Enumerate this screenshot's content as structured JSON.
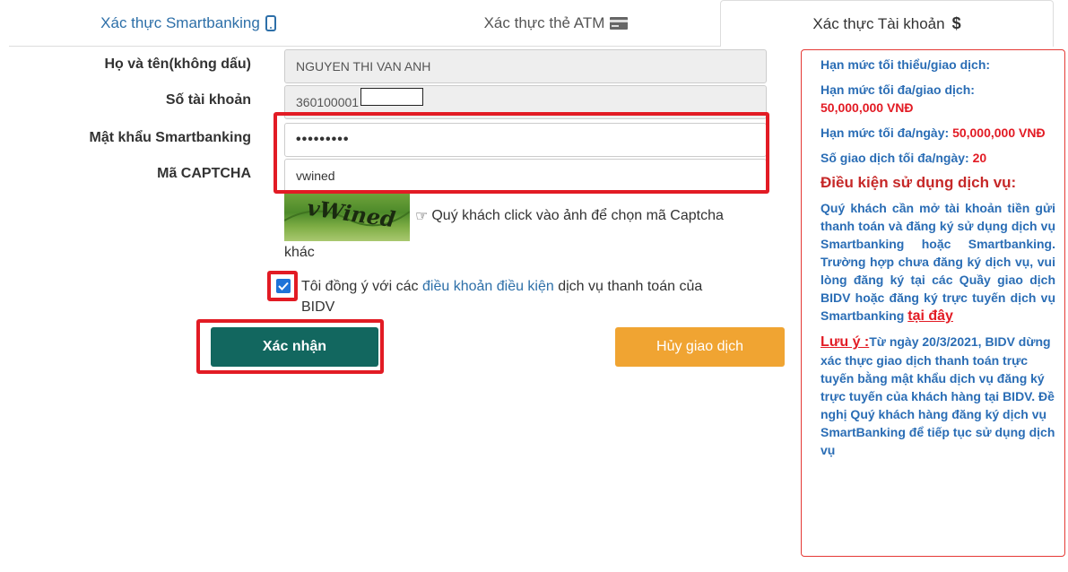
{
  "tabs": {
    "smartbanking": "Xác thực Smartbanking",
    "atm": "Xác thực thẻ ATM",
    "account": "Xác thực Tài khoản",
    "account_icon": "$"
  },
  "form": {
    "fullname_label": "Họ và tên(không dấu)",
    "fullname_value": "NGUYEN THI VAN ANH",
    "account_label": "Số tài khoản",
    "account_value": "360100001",
    "password_label": "Mật khẩu Smartbanking",
    "password_value": "•••••••••",
    "captcha_label": "Mã CAPTCHA",
    "captcha_value": "vwined",
    "captcha_image_text": "vWined",
    "captcha_hint": "Quý khách click vào ảnh để chọn mã Captcha",
    "captcha_hint_cont": "khác",
    "agree_prefix": "Tôi đồng ý với các ",
    "agree_link": "điều khoản điều kiện",
    "agree_suffix": " dịch vụ thanh toán của",
    "agree_line2": "BIDV",
    "agree_checked": true
  },
  "buttons": {
    "confirm": "Xác nhận",
    "cancel": "Hủy giao dịch"
  },
  "info": {
    "min_label": "Hạn mức tối thiểu/giao dịch:",
    "max_tx_label": "Hạn mức tối đa/giao dịch:",
    "max_tx_value": "50,000,000 VNĐ",
    "max_day_label": "Hạn mức tối đa/ngày: ",
    "max_day_value": "50,000,000 VNĐ",
    "count_label": "Số giao dịch tối đa/ngày: ",
    "count_value": "20",
    "cond_title": "Điều kiện sử dụng dịch vụ:",
    "cond_text": "Quý khách cần mở tài khoản tiền gửi thanh toán và đăng ký sử dụng dịch vụ Smartbanking hoặc Smartbanking. Trường hợp chưa đăng ký dịch vụ, vui lòng đăng ký tại các Quầy giao dịch BIDV hoặc đăng ký trực tuyến dịch vụ Smartbanking ",
    "cond_link": "tại đây",
    "note_label": "Lưu ý :",
    "note_text": "Từ ngày 20/3/2021, BIDV dừng xác thực giao dịch thanh toán trực tuyến bằng mật khẩu dịch vụ đăng ký trực tuyến của khách hàng tại BIDV. Đề nghị Quý khách hàng đăng ký dịch vụ SmartBanking để tiếp tục sử dụng dịch vụ"
  },
  "colors": {
    "confirm_bg": "#12675f",
    "cancel_bg": "#f0a432",
    "highlight": "#e21b24",
    "info_text": "#2a6db5"
  }
}
